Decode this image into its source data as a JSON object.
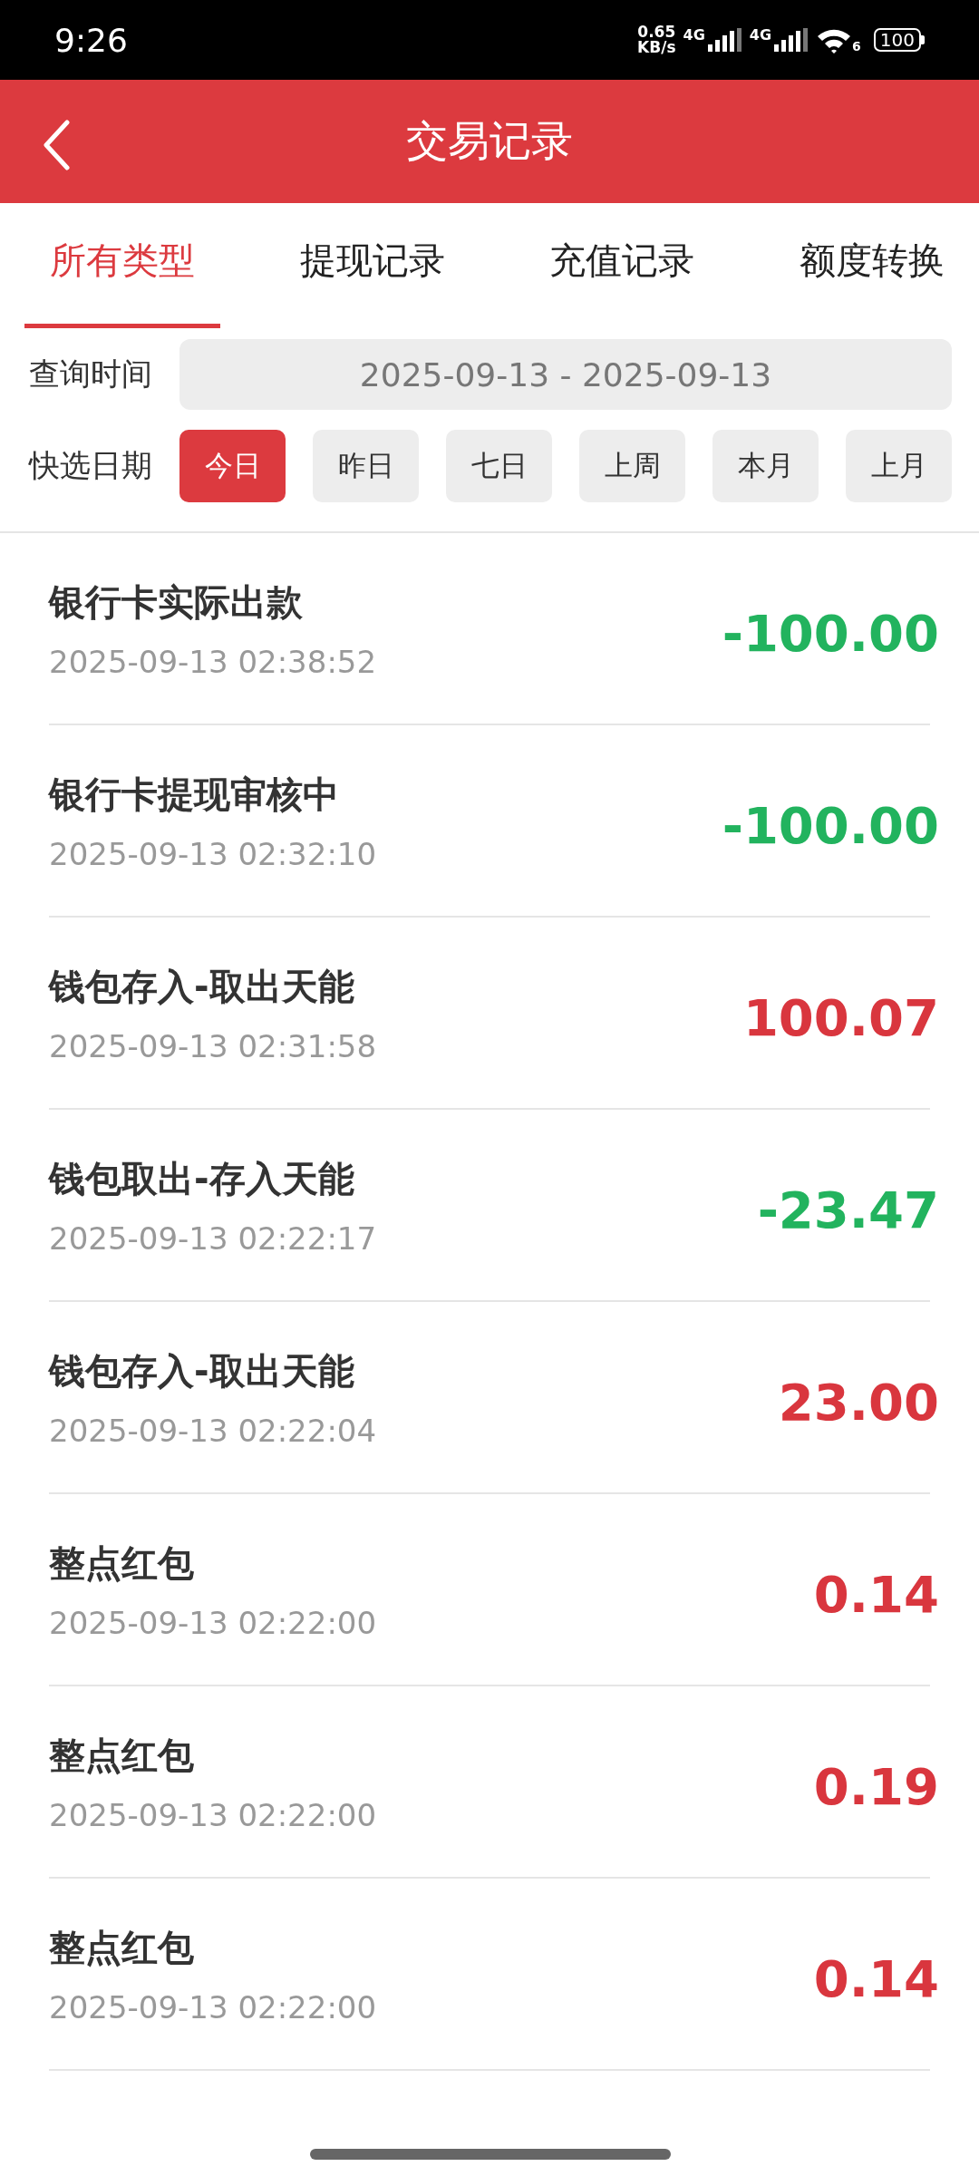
{
  "status_bar": {
    "time": "9:26",
    "speed_value": "0.65",
    "speed_unit": "KB/s",
    "networks": [
      "4G",
      "4G"
    ],
    "wifi_label": "6",
    "battery": "100"
  },
  "header": {
    "title": "交易记录"
  },
  "tabs": [
    {
      "label": "所有类型",
      "selected": true
    },
    {
      "label": "提现记录",
      "selected": false
    },
    {
      "label": "充值记录",
      "selected": false
    },
    {
      "label": "额度转换",
      "selected": false
    }
  ],
  "filter": {
    "query_label": "查询时间",
    "date_range": "2025-09-13 - 2025-09-13",
    "quick_label": "快选日期",
    "quick_options": [
      {
        "label": "今日",
        "selected": true
      },
      {
        "label": "昨日",
        "selected": false
      },
      {
        "label": "七日",
        "selected": false
      },
      {
        "label": "上周",
        "selected": false
      },
      {
        "label": "本月",
        "selected": false
      },
      {
        "label": "上月",
        "selected": false
      }
    ]
  },
  "records": [
    {
      "title": "银行卡实际出款",
      "time": "2025-09-13 02:38:52",
      "amount": "-100.00",
      "color": "#22b35e"
    },
    {
      "title": "银行卡提现审核中",
      "time": "2025-09-13 02:32:10",
      "amount": "-100.00",
      "color": "#22b35e"
    },
    {
      "title": "钱包存入-取出天能",
      "time": "2025-09-13 02:31:58",
      "amount": "100.07",
      "color": "#d9363e"
    },
    {
      "title": "钱包取出-存入天能",
      "time": "2025-09-13 02:22:17",
      "amount": "-23.47",
      "color": "#22b35e"
    },
    {
      "title": "钱包存入-取出天能",
      "time": "2025-09-13 02:22:04",
      "amount": "23.00",
      "color": "#d9363e"
    },
    {
      "title": "整点红包",
      "time": "2025-09-13 02:22:00",
      "amount": "0.14",
      "color": "#d9363e"
    },
    {
      "title": "整点红包",
      "time": "2025-09-13 02:22:00",
      "amount": "0.19",
      "color": "#d9363e"
    },
    {
      "title": "整点红包",
      "time": "2025-09-13 02:22:00",
      "amount": "0.14",
      "color": "#d9363e"
    }
  ]
}
